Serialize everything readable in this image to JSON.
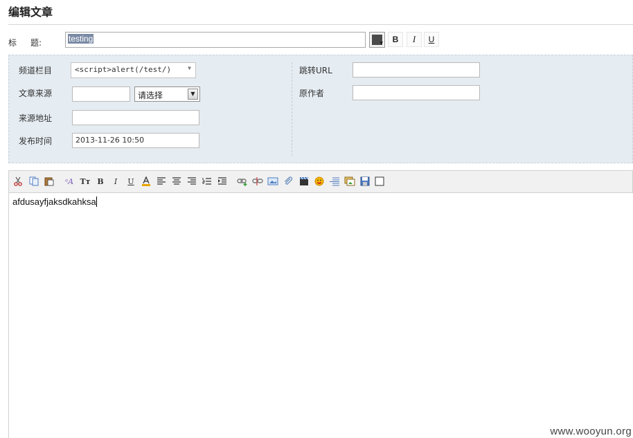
{
  "page": {
    "title": "编辑文章"
  },
  "title_row": {
    "label_first": "标",
    "label_second": "题:",
    "value": "testing",
    "color_swatch": "#4a4a4a",
    "bold_label": "B",
    "italic_label": "I",
    "underline_label": "U"
  },
  "meta": {
    "channel_label": "频道栏目",
    "channel_value": "<script>alert(/test/)",
    "source_label": "文章来源",
    "source_value": "",
    "source_select": "请选择",
    "source_url_label": "来源地址",
    "source_url_value": "",
    "publish_label": "发布时间",
    "publish_value": "2013-11-26 10:50",
    "redirect_label": "跳转URL",
    "redirect_value": "",
    "author_label": "原作者",
    "author_value": ""
  },
  "editor": {
    "toolbar": [
      "scissors-icon",
      "copy-icon",
      "paste-icon",
      "font-family-icon",
      "font-size-icon",
      "bold-icon",
      "italic-icon",
      "underline-icon",
      "font-color-icon",
      "align-left-icon",
      "align-center-icon",
      "align-right-icon",
      "ordered-list-icon",
      "indent-icon",
      "insert-link-icon",
      "unlink-icon",
      "insert-image-icon",
      "attachment-icon",
      "video-icon",
      "emoticon-icon",
      "horizontal-rule-icon",
      "image-gallery-icon",
      "save-icon",
      "checkbox-icon"
    ],
    "content": "afdusayfjaksdkahksa"
  },
  "watermark": "www.wooyun.org"
}
